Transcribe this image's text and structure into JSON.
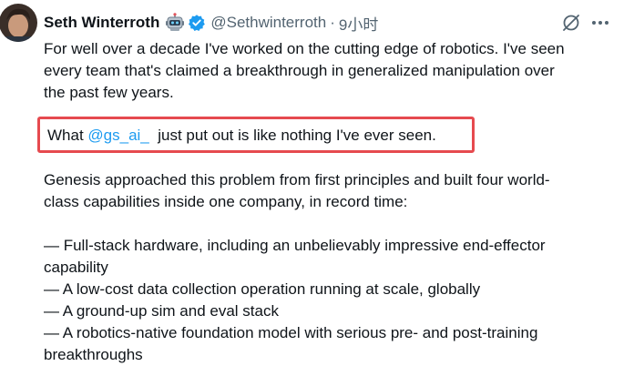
{
  "author": {
    "name": "Seth Winterroth",
    "handle": "@Sethwinterroth",
    "separator": "·",
    "time": "9小时",
    "avatar_icon": "avatar-photo",
    "badge_icons": [
      "robot-emoji-icon",
      "verified-badge-icon"
    ]
  },
  "actions": {
    "grok_icon": "grok-icon",
    "more_icon": "more-icon"
  },
  "tweet": {
    "para1": [
      "For well over a decade I've worked on the cutting edge of robotics. I've seen",
      "every team that's claimed a breakthrough in generalized manipulation over",
      "the past few years."
    ],
    "highlight_prefix": "What ",
    "highlight_mention": "@gs_ai_",
    "highlight_suffix": "  just put out is like nothing I've ever seen.",
    "para3": [
      "Genesis approached this problem from first principles and built four world-",
      "class capabilities inside one company, in record time:"
    ],
    "list": [
      "— Full-stack hardware, including an unbelievably impressive end-effector",
      "capability",
      "— A low-cost data collection operation running at scale, globally",
      "— A ground-up sim and eval stack",
      "— A robotics-native foundation model with serious pre- and post-training",
      "breakthroughs"
    ]
  },
  "colors": {
    "text": "#0f1419",
    "muted": "#536471",
    "mention": "#1d9bf0",
    "verified": "#1d9bf0",
    "highlight_border": "#e64a4f"
  }
}
